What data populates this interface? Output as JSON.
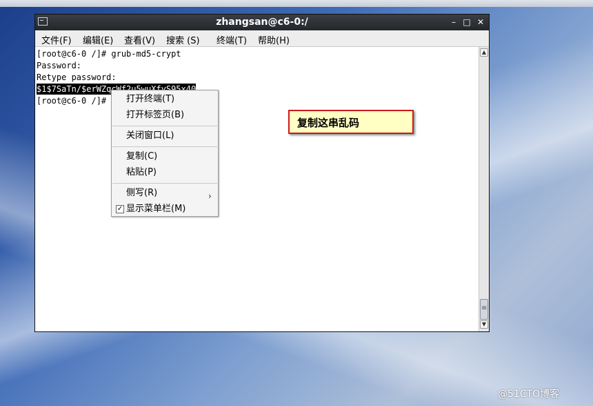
{
  "window": {
    "title": "zhangsan@c6-0:/",
    "controls": {
      "minimize": "–",
      "maximize": "□",
      "close": "✕"
    }
  },
  "menubar": {
    "items": [
      "文件(F)",
      "编辑(E)",
      "查看(V)",
      "搜索 (S)",
      "终端(T)",
      "帮助(H)"
    ]
  },
  "terminal": {
    "lines": [
      "[root@c6-0 /]# grub-md5-crypt",
      "Password:",
      "Retype password:",
      "$1$7SaTn/$erWZqcWf2u5wuXfyS95x40",
      "[root@c6-0 /]#"
    ]
  },
  "context_menu": {
    "open_terminal": "打开终端(T)",
    "open_tab": "打开标签页(B)",
    "close_window": "关闭窗口(L)",
    "copy": "复制(C)",
    "paste": "粘贴(P)",
    "input_methods": "侧写(R)",
    "show_menubar": "显示菜单栏(M)",
    "show_menubar_checked": true
  },
  "annotation": {
    "text": "复制这串乱码"
  },
  "watermark": {
    "text": "@51CTO博客"
  },
  "colors": {
    "annotation_border": "#cc1a1a",
    "annotation_fill": "#ffffc4"
  }
}
